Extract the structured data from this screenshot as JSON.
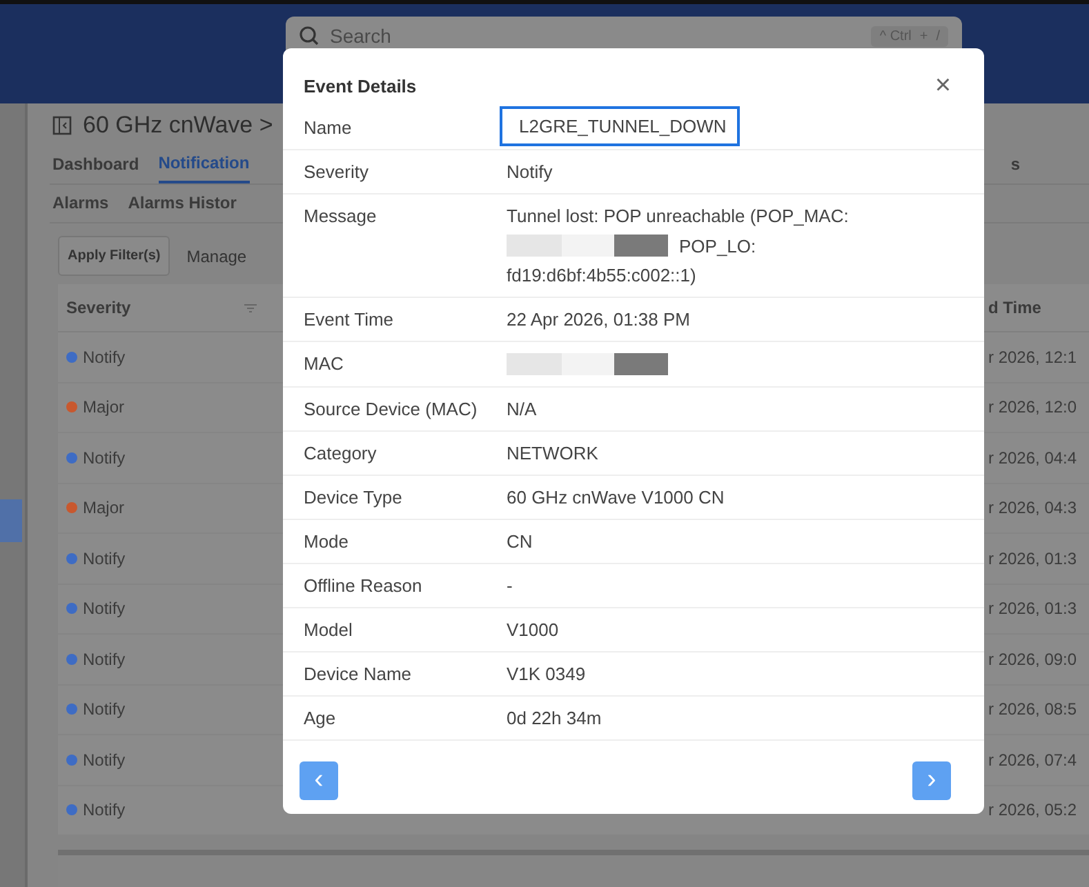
{
  "search": {
    "placeholder": "Search",
    "shortcut": [
      "^ Ctrl",
      "+",
      "/"
    ]
  },
  "page": {
    "title": "60 GHz cnWave >",
    "tabs": [
      {
        "label": "Dashboard",
        "selected": false
      },
      {
        "label": "Notification",
        "selected": true
      }
    ],
    "tab_partial": "s",
    "subtabs": [
      {
        "label": "Alarms",
        "selected": false
      },
      {
        "label": "Alarms Histor",
        "selected": false
      }
    ],
    "apply_button": "Apply Filter(s)",
    "manage_label": "Manage",
    "table": {
      "columns": [
        "Severity",
        "d Time"
      ],
      "rows": [
        {
          "severity": "Notify",
          "color": "#3e6cc4",
          "time": "r 2026, 12:1"
        },
        {
          "severity": "Major",
          "color": "#c8582e",
          "time": "r 2026, 12:0"
        },
        {
          "severity": "Notify",
          "color": "#3e6cc4",
          "time": "r 2026, 04:4"
        },
        {
          "severity": "Major",
          "color": "#c8582e",
          "time": "r 2026, 04:3"
        },
        {
          "severity": "Notify",
          "color": "#3e6cc4",
          "time": "r 2026, 01:3"
        },
        {
          "severity": "Notify",
          "color": "#3e6cc4",
          "time": "r 2026, 01:3"
        },
        {
          "severity": "Notify",
          "color": "#3e6cc4",
          "time": "r 2026, 09:0"
        },
        {
          "severity": "Notify",
          "color": "#3e6cc4",
          "time": "r 2026, 08:5"
        },
        {
          "severity": "Notify",
          "color": "#3e6cc4",
          "time": "r 2026, 07:4"
        },
        {
          "severity": "Notify",
          "color": "#3e6cc4",
          "time": "r 2026, 05:2"
        }
      ]
    }
  },
  "dialog": {
    "title": "Event Details",
    "close": "×",
    "fields": [
      {
        "label": "Name",
        "focused": true,
        "lines": [
          [
            {
              "kind": "text",
              "text": "L2GRE_TUNNEL_DOWN"
            }
          ]
        ]
      },
      {
        "label": "Severity",
        "focused": false,
        "lines": [
          [
            {
              "kind": "text",
              "text": "Notify"
            }
          ]
        ]
      },
      {
        "label": "Message",
        "focused": false,
        "lines": [
          [
            {
              "kind": "text",
              "text": "Tunnel lost: POP unreachable (POP_MAC:"
            }
          ],
          [
            {
              "kind": "redacted"
            },
            {
              "kind": "text",
              "text": "POP_LO:"
            }
          ],
          [
            {
              "kind": "text",
              "text": "fd19:d6bf:4b55:c002::1)"
            }
          ]
        ]
      },
      {
        "label": "Event Time",
        "focused": false,
        "lines": [
          [
            {
              "kind": "text",
              "text": "22 Apr 2026, 01:38 PM"
            }
          ]
        ]
      },
      {
        "label": "MAC",
        "focused": false,
        "lines": [
          [
            {
              "kind": "redacted"
            }
          ]
        ]
      },
      {
        "label": "Source Device (MAC)",
        "focused": false,
        "lines": [
          [
            {
              "kind": "text",
              "text": "N/A"
            }
          ]
        ]
      },
      {
        "label": "Category",
        "focused": false,
        "lines": [
          [
            {
              "kind": "text",
              "text": "NETWORK"
            }
          ]
        ]
      },
      {
        "label": "Device Type",
        "focused": false,
        "lines": [
          [
            {
              "kind": "text",
              "text": "60 GHz cnWave V1000 CN"
            }
          ]
        ]
      },
      {
        "label": "Mode",
        "focused": false,
        "lines": [
          [
            {
              "kind": "text",
              "text": "CN"
            }
          ]
        ]
      },
      {
        "label": "Offline Reason",
        "focused": false,
        "lines": [
          [
            {
              "kind": "text",
              "text": "-"
            }
          ]
        ]
      },
      {
        "label": "Model",
        "focused": false,
        "lines": [
          [
            {
              "kind": "text",
              "text": "V1000"
            }
          ]
        ]
      },
      {
        "label": "Device Name",
        "focused": false,
        "lines": [
          [
            {
              "kind": "text",
              "text": "V1K 0349"
            }
          ]
        ]
      },
      {
        "label": "Age",
        "focused": false,
        "lines": [
          [
            {
              "kind": "text",
              "text": "0d 22h 34m"
            }
          ]
        ]
      }
    ],
    "prev": "‹",
    "next": "›"
  }
}
